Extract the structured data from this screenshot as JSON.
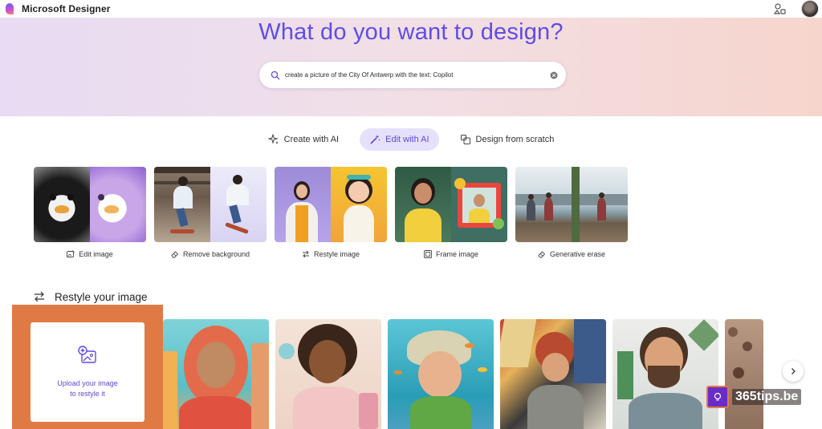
{
  "app": {
    "title": "Microsoft Designer"
  },
  "header": {
    "icons": [
      "apps-icon",
      "avatar"
    ]
  },
  "hero": {
    "title": "What do you want to design?",
    "search_value": "create a picture of the City Of Antwerp with the text: Copilot"
  },
  "tabs": [
    {
      "label": "Create with AI",
      "icon": "sparkle-icon",
      "active": false
    },
    {
      "label": "Edit with AI",
      "icon": "magic-wand-icon",
      "active": true
    },
    {
      "label": "Design from scratch",
      "icon": "shapes-icon",
      "active": false
    }
  ],
  "features": [
    {
      "label": "Edit image",
      "icon": "image-edit-icon"
    },
    {
      "label": "Remove background",
      "icon": "eraser-icon"
    },
    {
      "label": "Restyle image",
      "icon": "swap-icon"
    },
    {
      "label": "Frame image",
      "icon": "frame-icon"
    },
    {
      "label": "Generative erase",
      "icon": "eraser-icon"
    }
  ],
  "restyle": {
    "title": "Restyle your image",
    "upload_line1": "Upload your image",
    "upload_line2": "to restyle it"
  },
  "watermark": {
    "text": "365tips.be"
  },
  "colors": {
    "accent": "#5f4de6",
    "active_tab_bg": "#e6e1fb",
    "highlight": "#e07a45"
  }
}
